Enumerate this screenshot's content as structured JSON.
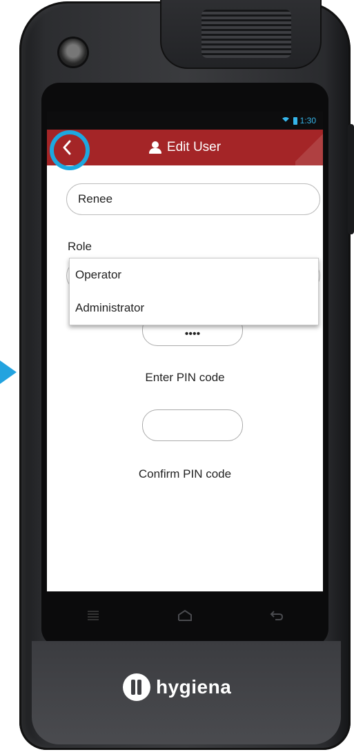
{
  "status_bar": {
    "time": "1:30",
    "wifi_icon": "wifi-icon",
    "battery_icon": "battery-icon"
  },
  "header": {
    "title": "Edit User",
    "back_icon": "chevron-left-icon",
    "user_icon": "user-icon"
  },
  "form": {
    "name_value": "Renee",
    "role_label": "Role",
    "role_options": [
      "Operator",
      "Administrator"
    ],
    "pin_value": "••••",
    "pin_label": "Enter PIN code",
    "confirm_value": "",
    "confirm_label": "Confirm PIN code"
  },
  "nav": {
    "menu_icon": "menu-icon",
    "home_icon": "home-icon",
    "back_icon": "back-icon"
  },
  "brand": {
    "logo_text": "hygiena"
  },
  "colors": {
    "header": "#a42527",
    "accent": "#1da8e0"
  }
}
